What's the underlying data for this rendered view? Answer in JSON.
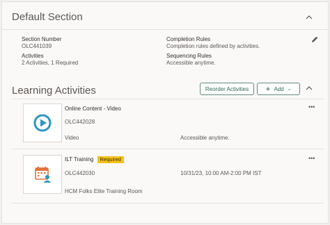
{
  "section": {
    "title": "Default Section",
    "section_number_label": "Section Number",
    "section_number_value": "OLC441039",
    "activities_label": "Activities",
    "activities_value": "2 Activities, 1 Required",
    "completion_rules_label": "Completion Rules",
    "completion_rules_value": "Completion rules defined by activities.",
    "sequencing_rules_label": "Sequencing Rules",
    "sequencing_rules_value": "Accessible anytime."
  },
  "learning": {
    "title": "Learning Activities",
    "reorder_label": "Reorder Activities",
    "add_label": "Add",
    "items": [
      {
        "name": "Online Content - Video",
        "id": "OLC442028",
        "type": "Video",
        "access": "Accessible anytime.",
        "icon": "video-play-icon"
      },
      {
        "name": "ILT Training",
        "badge": "Required",
        "id": "OLC442030",
        "date": "10/31/23, 10:00 AM-2:00 PM IST",
        "location": "HCM Folks Elite Training Room",
        "icon": "calendar-person-icon"
      }
    ]
  },
  "colors": {
    "accent": "#2f6b55",
    "badge": "#f5c21b",
    "video_icon": "#2b96c4"
  }
}
